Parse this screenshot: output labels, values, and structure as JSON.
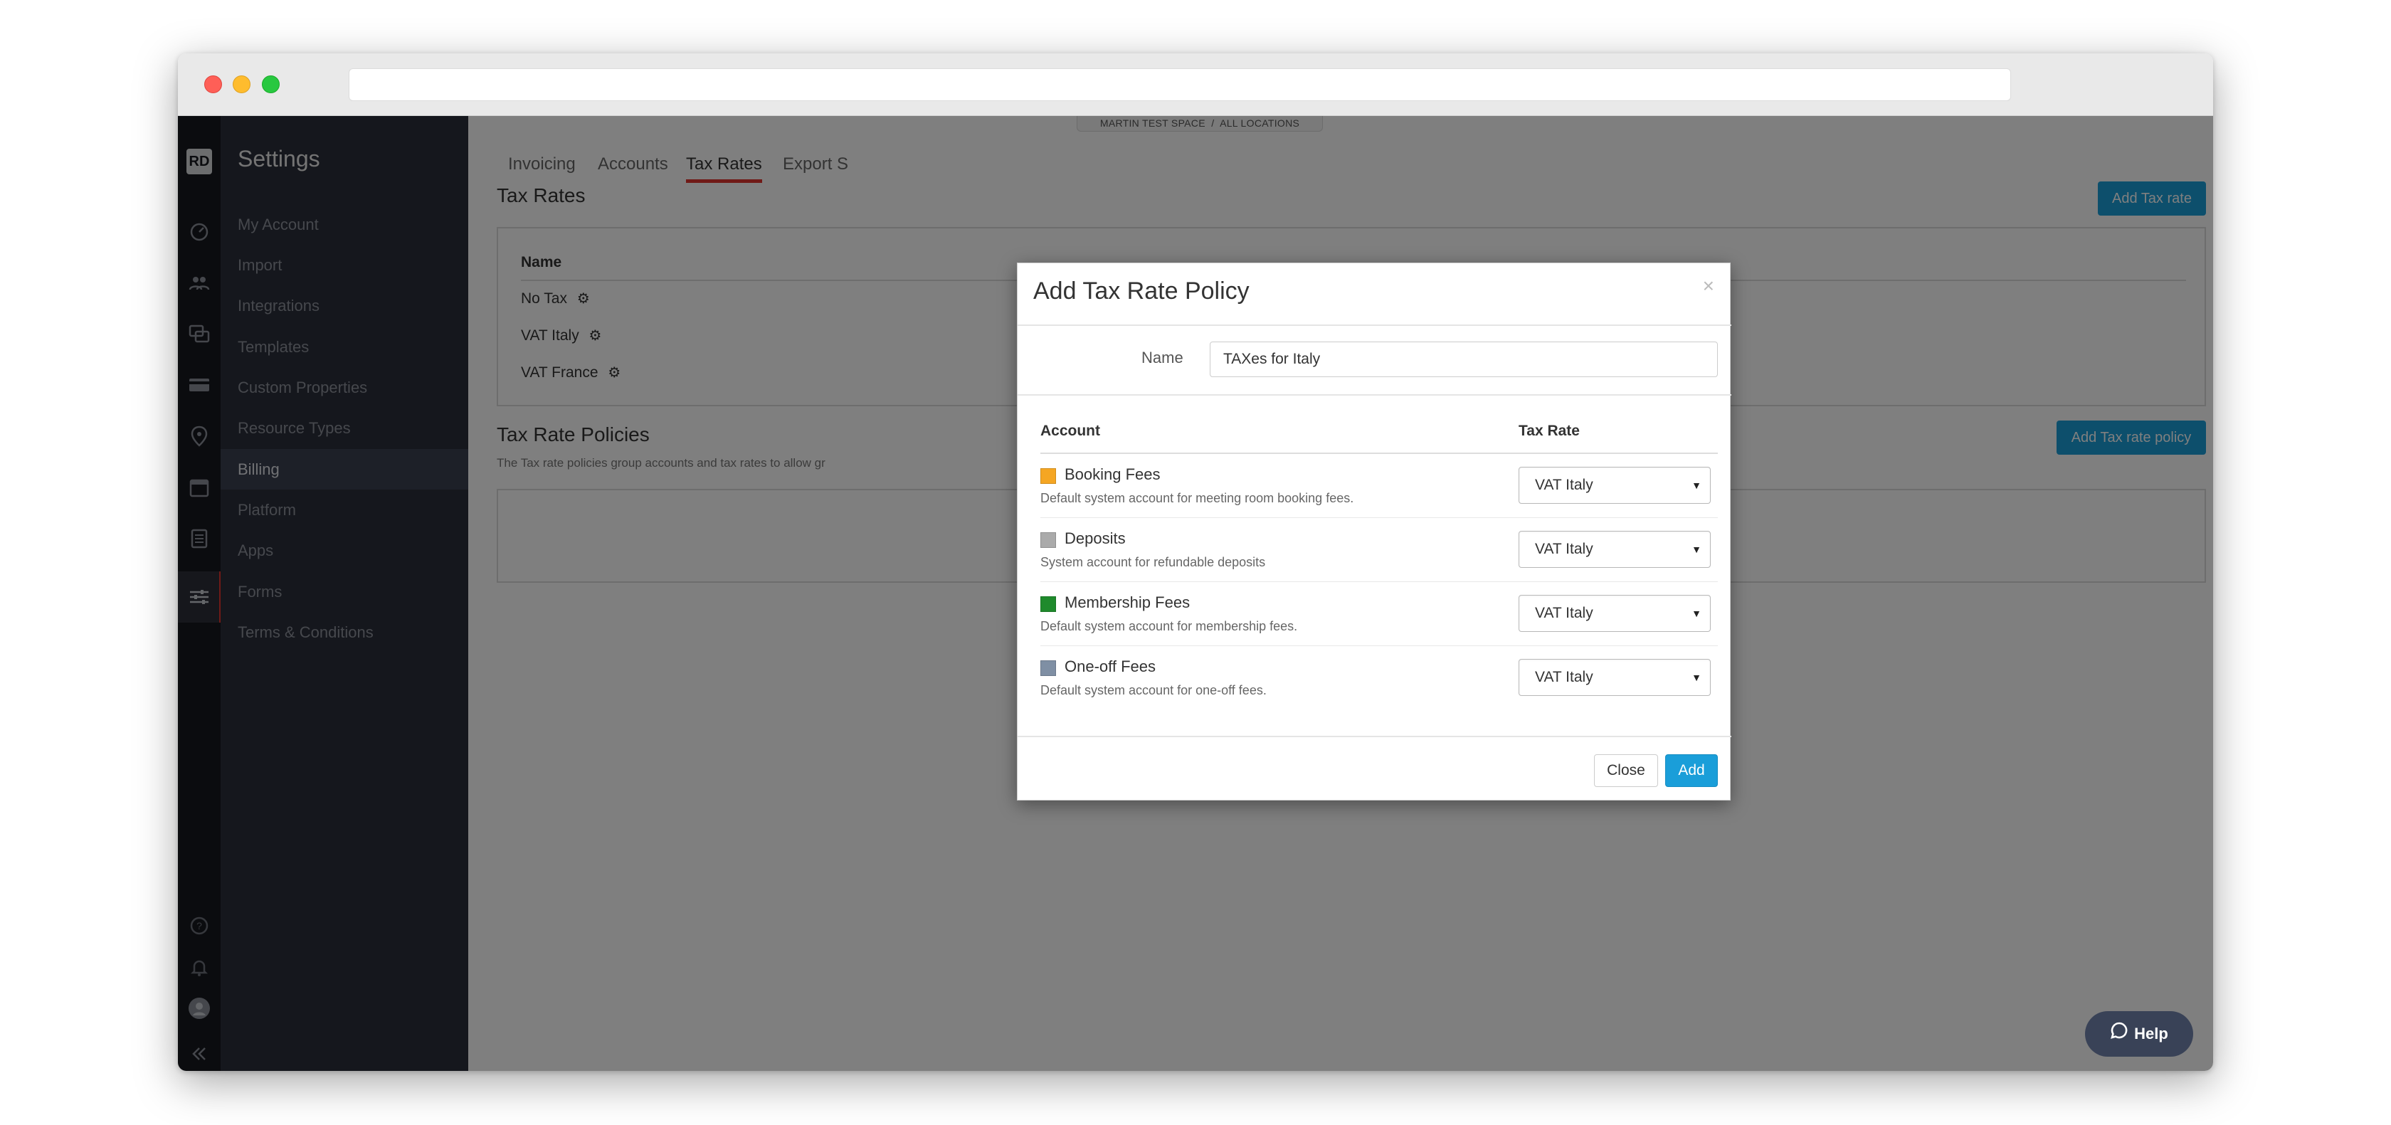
{
  "breadcrumb": {
    "space": "MARTIN TEST SPACE",
    "divider": "/",
    "location": "ALL LOCATIONS"
  },
  "logo": {
    "text": "RD"
  },
  "sidebar": {
    "title": "Settings",
    "items": [
      {
        "label": "My Account"
      },
      {
        "label": "Import"
      },
      {
        "label": "Integrations"
      },
      {
        "label": "Templates"
      },
      {
        "label": "Custom Properties"
      },
      {
        "label": "Resource Types"
      },
      {
        "label": "Billing"
      },
      {
        "label": "Platform"
      },
      {
        "label": "Apps"
      },
      {
        "label": "Forms"
      },
      {
        "label": "Terms & Conditions"
      }
    ]
  },
  "tabs": [
    {
      "label": "Invoicing"
    },
    {
      "label": "Accounts"
    },
    {
      "label": "Tax Rates"
    },
    {
      "label": "Export S"
    }
  ],
  "tax_rates": {
    "title": "Tax Rates",
    "add_button": "Add Tax rate",
    "column_name": "Name",
    "rows": [
      {
        "name": "No Tax"
      },
      {
        "name": "VAT Italy"
      },
      {
        "name": "VAT France"
      }
    ]
  },
  "tax_rate_policies": {
    "title": "Tax Rate Policies",
    "description": "The Tax rate policies group accounts and tax rates to allow gr",
    "add_button": "Add Tax rate policy"
  },
  "help": {
    "label": "Help"
  },
  "modal": {
    "title": "Add Tax Rate Policy",
    "close_x": "×",
    "name_label": "Name",
    "name_value": "TAXes for Italy",
    "col_account": "Account",
    "col_tax_rate": "Tax Rate",
    "accounts": [
      {
        "name": "Booking Fees",
        "description": "Default system account for meeting room booking fees.",
        "color": "#f5a623",
        "tax_rate": "VAT Italy"
      },
      {
        "name": "Deposits",
        "description": "System account for refundable deposits",
        "color": "#aaaaaa",
        "tax_rate": "VAT Italy"
      },
      {
        "name": "Membership Fees",
        "description": "Default system account for membership fees.",
        "color": "#1f8a2c",
        "tax_rate": "VAT Italy"
      },
      {
        "name": "One-off Fees",
        "description": "Default system account for one-off fees.",
        "color": "#7f8fa4",
        "tax_rate": "VAT Italy"
      }
    ],
    "close_button": "Close",
    "add_button": "Add"
  }
}
